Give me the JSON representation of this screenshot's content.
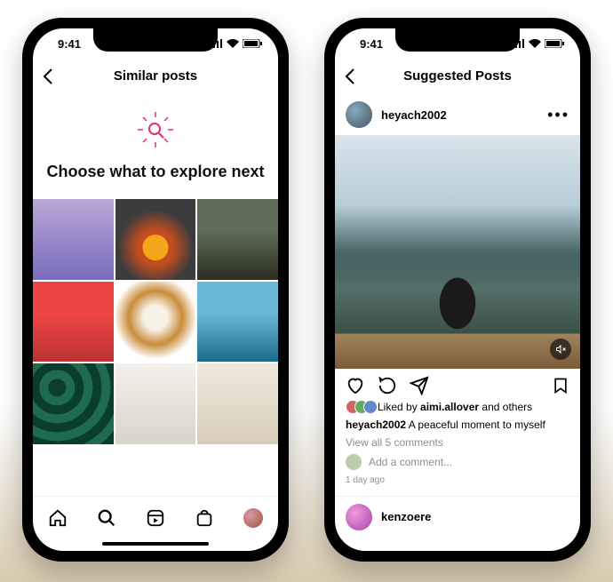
{
  "status": {
    "time": "9:41"
  },
  "phone1": {
    "header_title": "Similar posts",
    "hero_title": "Choose what to explore next"
  },
  "phone2": {
    "header_title": "Suggested Posts",
    "post": {
      "username": "heyach2002",
      "likes_prefix": "Liked by ",
      "likes_name": "aimi.allover",
      "likes_suffix": " and others",
      "caption_user": "heyach2002",
      "caption_text": " A peaceful moment to myself",
      "view_all": "View all 5 comments",
      "add_comment": "Add a comment...",
      "time": "1 day ago"
    },
    "next_user": "kenzoere"
  }
}
